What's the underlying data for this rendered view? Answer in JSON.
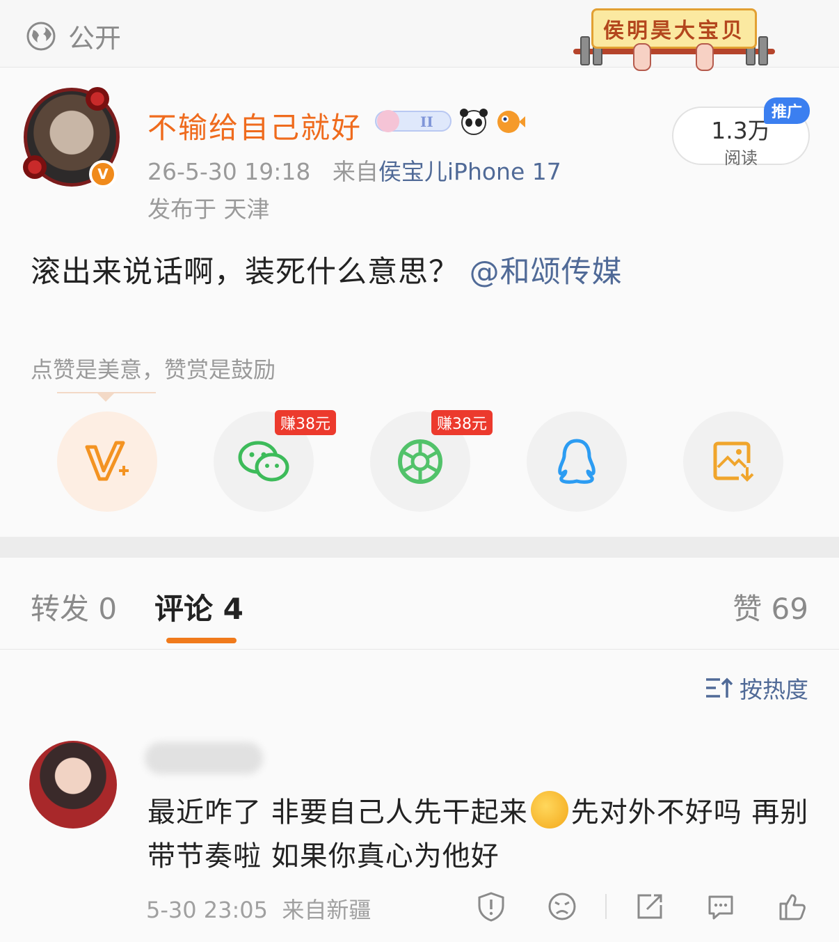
{
  "topbar": {
    "visibility_icon": "globe-icon",
    "visibility_label": "公开",
    "badge_text": "侯明昊大宝贝"
  },
  "post": {
    "username": "不输给自己就好",
    "timestamp": "26-5-30 19:18",
    "source_prefix": "来自",
    "source_device": "侯宝儿iPhone 17",
    "location": "发布于 天津",
    "read_count": "1.3万",
    "read_label": "阅读",
    "promo_badge": "推广",
    "content_text": "滚出来说话啊，装死什么意思？",
    "mention": "@和颂传媒",
    "reward_hint": "点赞是美意，赞赏是鼓励"
  },
  "share": {
    "buttons": [
      {
        "icon": "v-plus-reward-icon"
      },
      {
        "icon": "wechat-icon",
        "earn": "赚38元"
      },
      {
        "icon": "moments-aperture-icon",
        "earn": "赚38元"
      },
      {
        "icon": "qq-penguin-icon"
      },
      {
        "icon": "save-image-icon"
      }
    ]
  },
  "tabs": {
    "repost": "转发 0",
    "comments": "评论 4",
    "likes": "赞 69"
  },
  "sort": {
    "label": "按热度",
    "icon": "sort-icon"
  },
  "comment": {
    "text_before_emoji": "最近咋了 非要自己人先干起来",
    "text_after_emoji": "先对外不好吗 再别带节奏啦 如果你真心为他好",
    "emoji": "thinking-face-emoji",
    "time": "5-30 23:05",
    "source": "来自新疆",
    "actions": [
      "report-icon",
      "dislike-face-icon",
      "share-icon",
      "reply-icon",
      "like-icon"
    ]
  },
  "colors": {
    "accent_orange": "#ef6b1d",
    "link_blue": "#506a97",
    "earn_red": "#ec3a2d",
    "promo_blue": "#3b7ff0"
  }
}
